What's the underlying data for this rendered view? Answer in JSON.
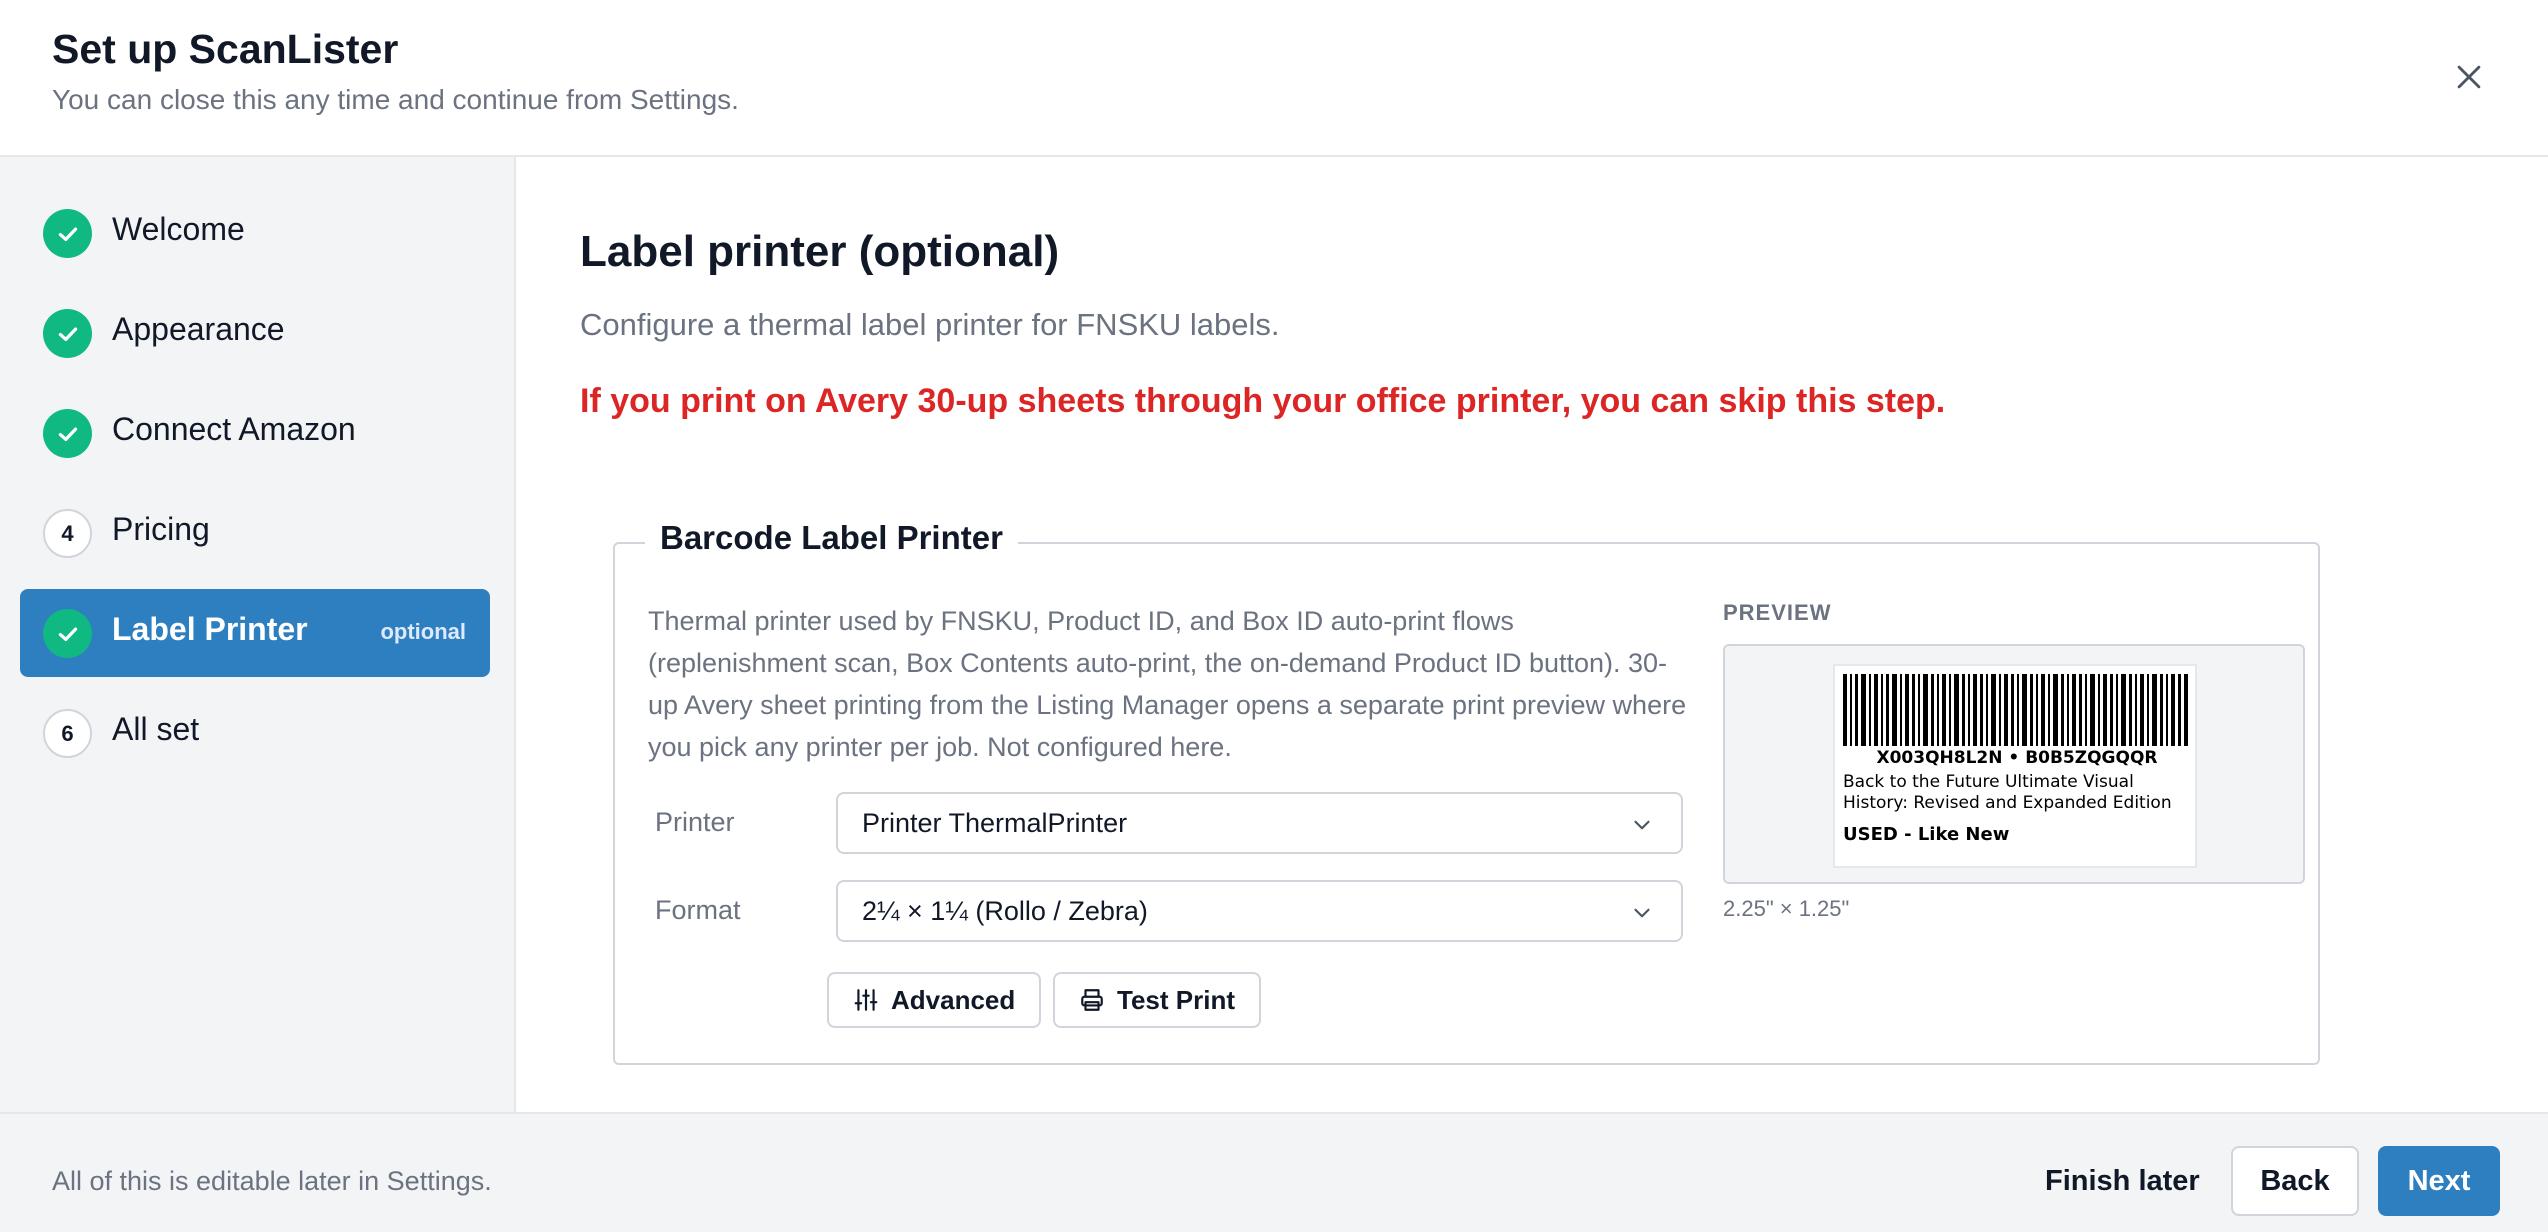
{
  "header": {
    "title": "Set up ScanLister",
    "subtitle": "You can close this any time and continue from Settings."
  },
  "sidebar": {
    "steps": [
      {
        "label": "Welcome",
        "status": "done",
        "icon": "check-icon"
      },
      {
        "label": "Appearance",
        "status": "done",
        "icon": "check-icon"
      },
      {
        "label": "Connect Amazon",
        "status": "done",
        "icon": "check-icon"
      },
      {
        "label": "Pricing",
        "status": "pending",
        "number": "4"
      },
      {
        "label": "Label Printer",
        "status": "active",
        "icon": "check-icon",
        "badge": "optional"
      },
      {
        "label": "All set",
        "status": "pending",
        "number": "6"
      }
    ]
  },
  "main": {
    "title": "Label printer (optional)",
    "description": "Configure a thermal label printer for FNSKU labels.",
    "warning": "If you print on Avery 30-up sheets through your office printer, you can skip this step.",
    "panel": {
      "legend": "Barcode Label Printer",
      "description": "Thermal printer used by FNSKU, Product ID, and Box ID auto-print flows (replenishment scan, Box Contents auto-print, the on-demand Product ID button). 30-up Avery sheet printing from the Listing Manager opens a separate print preview where you pick any printer per job. Not configured here.",
      "printer_label": "Printer",
      "printer_value": "Printer ThermalPrinter",
      "format_label": "Format",
      "format_value": "2¼ × 1¼ (Rollo / Zebra)",
      "advanced_label": "Advanced",
      "test_print_label": "Test Print",
      "preview": {
        "heading": "PREVIEW",
        "codes": "X003QH8L2N • B0B5ZQGQQR",
        "title": "Back to the Future Ultimate Visual History: Revised and Expanded Edition",
        "condition": "USED - Like New",
        "size": "2.25\" × 1.25\""
      }
    }
  },
  "footer": {
    "note": "All of this is editable later in Settings.",
    "finish_later": "Finish later",
    "back": "Back",
    "next": "Next"
  },
  "colors": {
    "accent": "#2e7fbf",
    "success": "#10b981",
    "warning": "#dc2626"
  }
}
